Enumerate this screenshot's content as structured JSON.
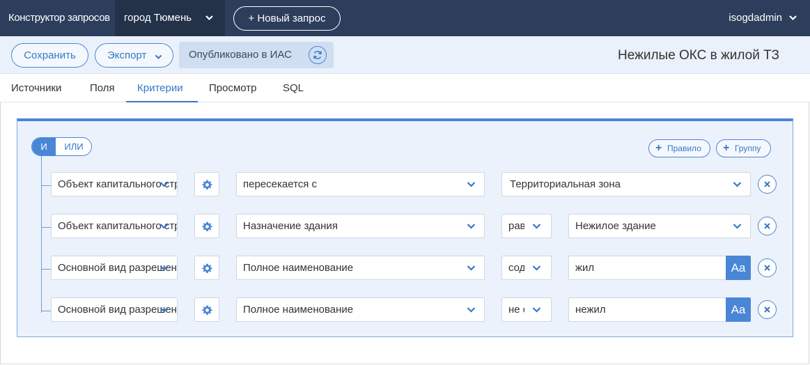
{
  "navbar": {
    "brand": "Конструктор запросов",
    "city": "город Тюмень",
    "new_query": "+ Новый запрос",
    "user": "isogdadmin"
  },
  "toolbar": {
    "save": "Сохранить",
    "export": "Экспорт",
    "published": "Опубликовано в ИАС",
    "query_title": "Нежилые ОКС в жилой ТЗ"
  },
  "tabs": [
    "Источники",
    "Поля",
    "Критерии",
    "Просмотр",
    "SQL"
  ],
  "active_tab": "Критерии",
  "criteria": {
    "and_label": "И",
    "or_label": "ИЛИ",
    "add_rule": "Правило",
    "add_group": "Группу",
    "rules": [
      {
        "source": "Объект капитального строительства",
        "field": "пересекается с",
        "operator": "",
        "value": "Территориальная зона",
        "value_type": "select"
      },
      {
        "source": "Объект капитального строительства",
        "field": "Назначение здания",
        "operator": "равно",
        "value": "Нежилое здание",
        "value_type": "select"
      },
      {
        "source": "Основной вид разрешенного использования",
        "field": "Полное наименование",
        "operator": "содержит",
        "value": "жил",
        "value_type": "text"
      },
      {
        "source": "Основной вид разрешенного использования",
        "field": "Полное наименование",
        "operator": "не содержит",
        "value": "нежил",
        "value_type": "text"
      }
    ]
  },
  "colors": {
    "navbar": "#2c3e5c",
    "accent": "#4a86d6",
    "panel": "#ebf2fb"
  },
  "icons": {
    "chevron": "chevron-down-icon",
    "sync": "sync-icon",
    "settings": "gear-icon",
    "remove": "close-icon",
    "case": "font-case-icon"
  },
  "case_label": "Aa"
}
